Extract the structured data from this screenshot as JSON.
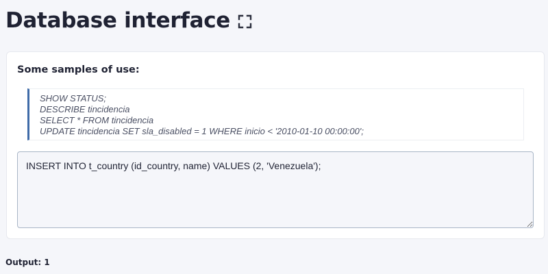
{
  "header": {
    "title": "Database interface",
    "fullscreen_icon": "fullscreen-icon"
  },
  "samples_card": {
    "heading": "Some samples of use:",
    "samples": [
      "SHOW STATUS;",
      "DESCRIBE tincidencia",
      "SELECT * FROM tincidencia",
      "UPDATE tincidencia SET sla_disabled = 1 WHERE inicio < '2010-01-10 00:00:00';"
    ],
    "query": {
      "value": "INSERT INTO t_country (id_country, name) VALUES (2, 'Venezuela');",
      "placeholder": ""
    }
  },
  "output": {
    "text": "Output: 1"
  },
  "colors": {
    "accent": "#3f6ba8",
    "background": "#f5f6fa",
    "text": "#1f2233"
  }
}
